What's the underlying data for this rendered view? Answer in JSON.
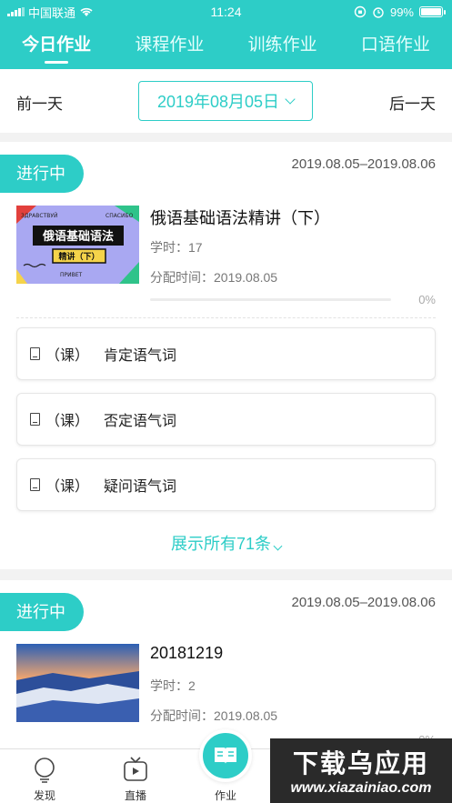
{
  "status": {
    "carrier": "中国联通",
    "time": "11:24",
    "battery": "99%",
    "battery_level": 0.99
  },
  "tabs": [
    {
      "label": "今日作业",
      "active": true
    },
    {
      "label": "课程作业",
      "active": false
    },
    {
      "label": "训练作业",
      "active": false
    },
    {
      "label": "口语作业",
      "active": false
    }
  ],
  "datebar": {
    "prev_label": "前一天",
    "date": "2019年08月05日",
    "next_label": "后一天"
  },
  "cards": [
    {
      "status": "进行中",
      "range": "2019.08.05–2019.08.06",
      "thumb": {
        "top_left": "ЗДРАВСТВУЙ",
        "top_right": "СПАСИБО",
        "main": "俄语基础语法",
        "sub": "精讲（下）",
        "bottom": "ПРИВЕТ"
      },
      "title": "俄语基础语法精讲（下）",
      "hours": "学时：17",
      "assigned": "分配时间：2019.08.05",
      "progress": 0,
      "pct": "0%",
      "lessons": [
        {
          "tag": "（课）",
          "name": "肯定语气词"
        },
        {
          "tag": "（课）",
          "name": "否定语气词"
        },
        {
          "tag": "（课）",
          "name": "疑问语气词"
        }
      ],
      "expand_label": "展示所有71条"
    },
    {
      "status": "进行中",
      "range": "2019.08.05–2019.08.06",
      "title": "20181219",
      "hours": "学时：2",
      "assigned": "分配时间：2019.08.05",
      "pct": "0%"
    }
  ],
  "nav": {
    "discover": "发现",
    "live": "直播",
    "homework": "作业"
  },
  "watermark": {
    "line1": "下载乌应用",
    "line2": "www.xiazainiao.com"
  },
  "colors": {
    "accent": "#2dcdc7"
  }
}
